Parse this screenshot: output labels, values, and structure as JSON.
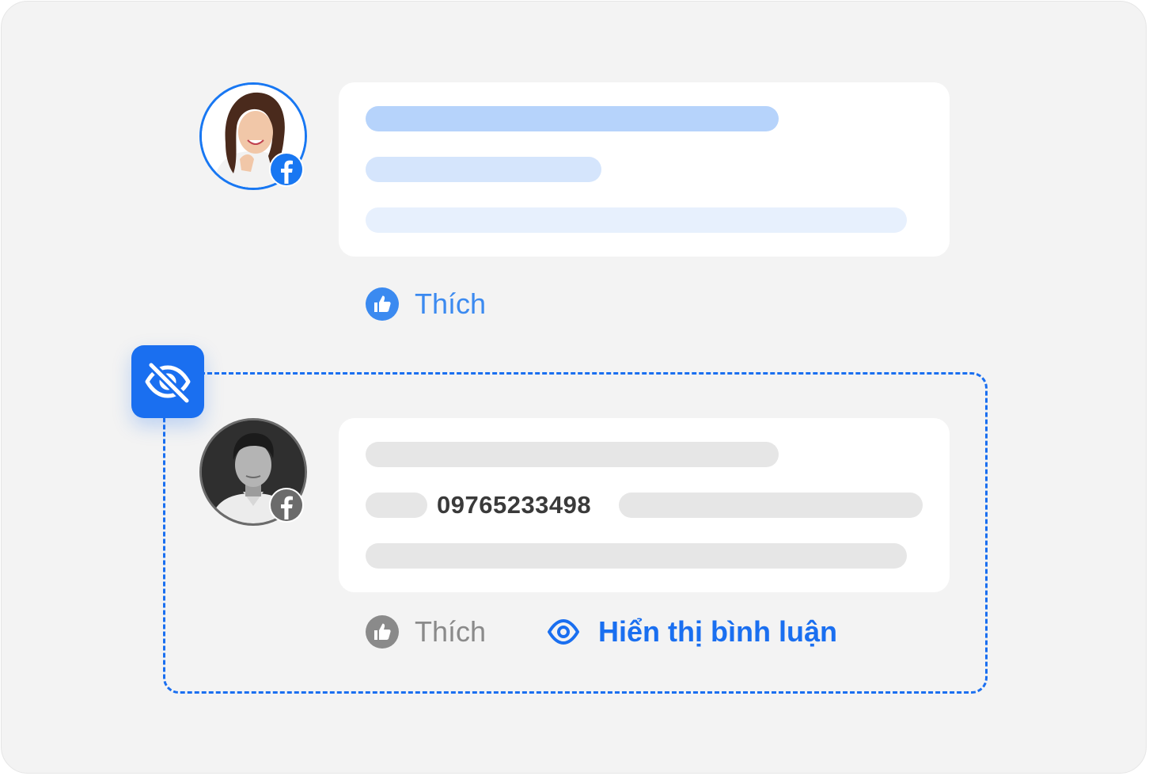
{
  "colors": {
    "facebook_blue": "#1877f2",
    "accent_blue": "#1a6ff0",
    "like_active": "#3b8af0",
    "like_muted": "#8a8a8a",
    "background": "#f3f3f3",
    "placeholder_gray": "#e6e6e6"
  },
  "visible_comment": {
    "avatar_icon": "facebook-icon",
    "like_label": "Thích"
  },
  "hidden_comment": {
    "status_icon": "eye-off-icon",
    "avatar_icon": "facebook-icon",
    "phone_number": "09765233498",
    "like_label": "Thích",
    "show_comment_label": "Hiển thị bình luận"
  }
}
